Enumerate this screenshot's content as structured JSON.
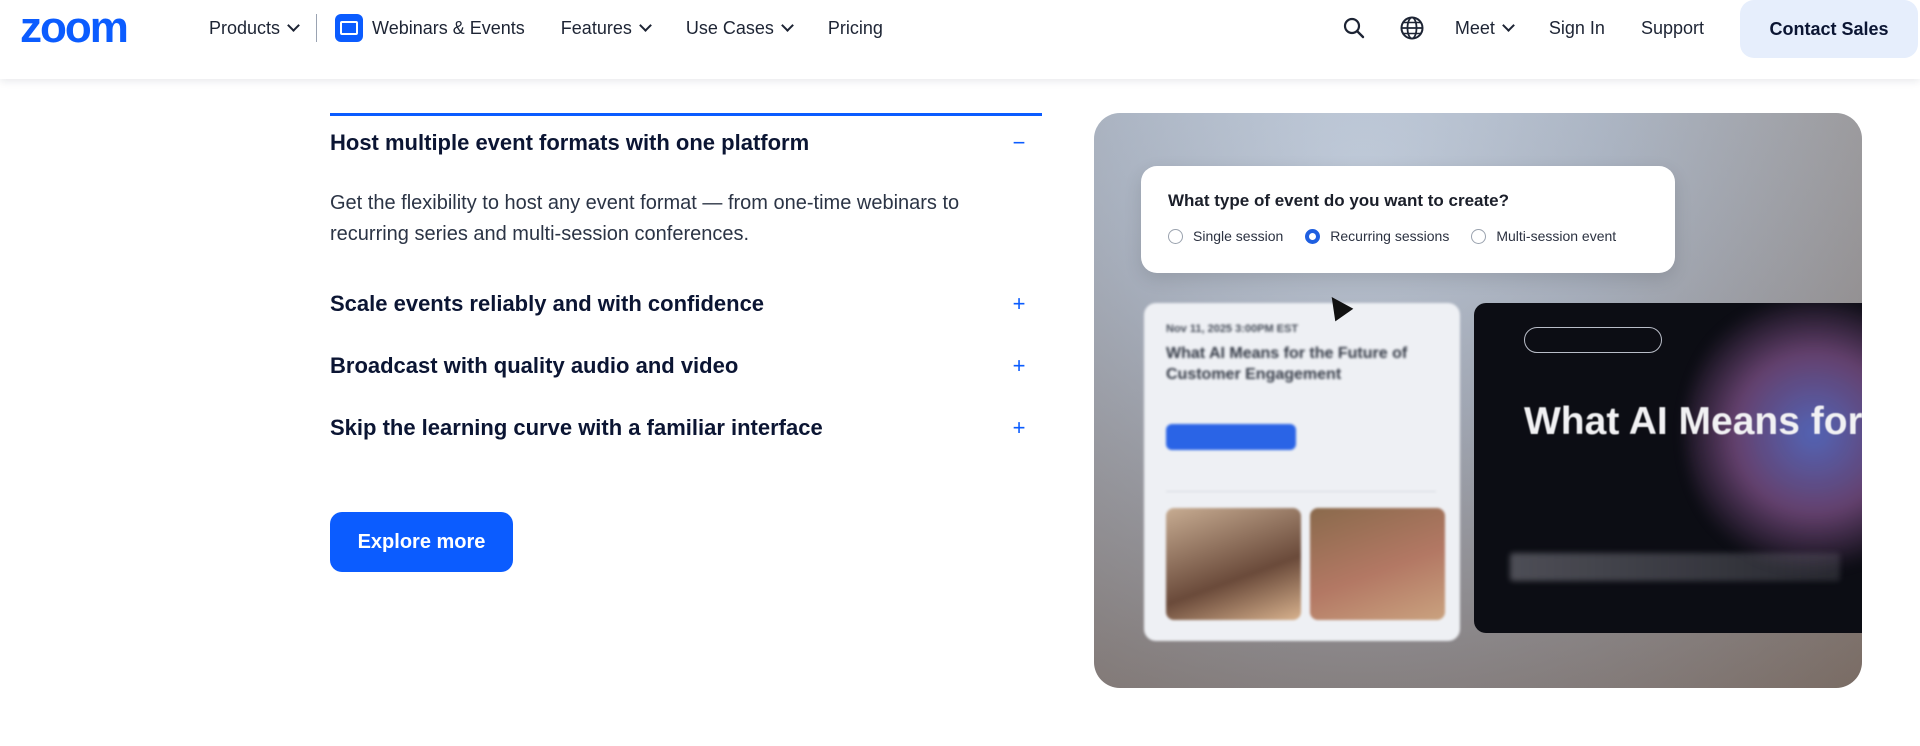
{
  "header": {
    "logo": "zoom",
    "nav": {
      "products": "Products",
      "webinars": "Webinars & Events",
      "features": "Features",
      "use_cases": "Use Cases",
      "pricing": "Pricing"
    },
    "right": {
      "meet": "Meet",
      "sign_in": "Sign In",
      "support": "Support",
      "contact_sales": "Contact Sales"
    }
  },
  "accordion": {
    "items": [
      {
        "title": "Host multiple event formats with one platform",
        "toggle": "−",
        "expanded": true,
        "body": "Get the flexibility to host any event format — from one-time webinars to recurring series and multi-session conferences."
      },
      {
        "title": "Scale events reliably and with confidence",
        "toggle": "+",
        "expanded": false
      },
      {
        "title": "Broadcast with quality audio and video",
        "toggle": "+",
        "expanded": false
      },
      {
        "title": "Skip the learning curve with a familiar interface",
        "toggle": "+",
        "expanded": false
      }
    ]
  },
  "cta": {
    "explore_more": "Explore more"
  },
  "visual": {
    "question": "What type of event do you want to create?",
    "options": [
      "Single session",
      "Recurring sessions",
      "Multi-session event"
    ],
    "selected_option": "Recurring sessions",
    "event_card": {
      "date": "Nov 11, 2025 3:00PM EST",
      "title": "What AI Means for the Future of Customer Engagement"
    },
    "promo": {
      "title": "What AI Means for the Future of Customer Engagement"
    }
  },
  "colors": {
    "brand_blue": "#0b5cff",
    "text_dark": "#0b1533",
    "contact_bg": "#e6eefc"
  },
  "icons": [
    "search-icon",
    "globe-icon",
    "chevron-down-icon",
    "webinar-icon",
    "minus-icon",
    "plus-icon",
    "cursor-icon"
  ]
}
